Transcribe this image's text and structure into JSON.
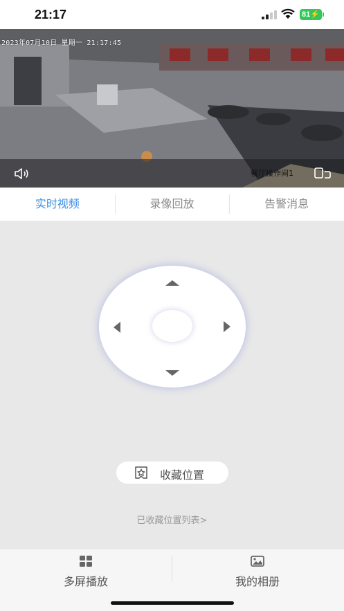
{
  "status_bar": {
    "time": "21:17",
    "battery": "81"
  },
  "video": {
    "osd_text": "2023年07月10日 星期一 21:17:45",
    "camera_name": "餐厅操作间1",
    "volume_icon": "speaker-icon",
    "fullscreen_icon": "fullscreen-icon"
  },
  "tabs": [
    {
      "label": "实时视频",
      "active": true
    },
    {
      "label": "录像回放",
      "active": false
    },
    {
      "label": "告警消息",
      "active": false
    }
  ],
  "ptz": {
    "up_icon": "arrow-up-icon",
    "down_icon": "arrow-down-icon",
    "left_icon": "arrow-left-icon",
    "right_icon": "arrow-right-icon"
  },
  "favorite": {
    "button_label": "收藏位置",
    "list_link": "已收藏位置列表>"
  },
  "bottom_nav": [
    {
      "label": "多屏播放",
      "icon": "grid-icon"
    },
    {
      "label": "我的相册",
      "icon": "image-icon"
    }
  ],
  "colors": {
    "accent": "#3a8ee6",
    "battery": "#34c759"
  }
}
